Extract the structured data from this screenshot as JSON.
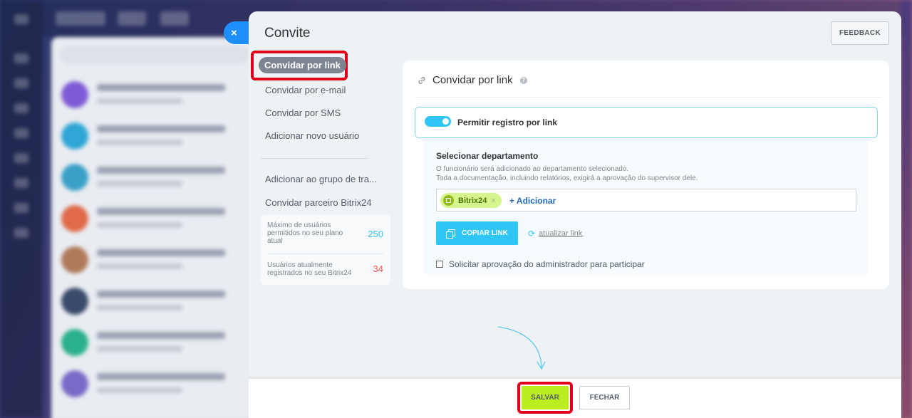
{
  "panel": {
    "title": "Convite",
    "feedback_label": "FEEDBACK",
    "close_glyph": "×"
  },
  "nav": {
    "items": [
      {
        "label": "Convidar por link",
        "active": true
      },
      {
        "label": "Convidar por e-mail"
      },
      {
        "label": "Convidar por SMS"
      },
      {
        "label": "Adicionar novo usuário"
      },
      {
        "label": "Adicionar ao grupo de tra..."
      },
      {
        "label": "Convidar parceiro Bitrix24"
      }
    ],
    "limits": [
      {
        "text": "Máximo de usuários permitidos no seu plano atual",
        "value": "250",
        "color": "#2fc6f6"
      },
      {
        "text": "Usuários atualmente registrados no seu Bitrix24",
        "value": "34",
        "color": "#ff5752"
      }
    ]
  },
  "card": {
    "title": "Convidar por link",
    "help_glyph": "?",
    "toggle_label": "Permitir registro por link",
    "toggle_on": true,
    "dept_title": "Selecionar departamento",
    "dept_desc_1": "O funcionário será adicionado ao departamento selecionado.",
    "dept_desc_2": "Toda a documentação, incluindo relatórios, exigirá a aprovação do supervisor dele.",
    "tag_label": "Bitrix24",
    "tag_remove": "×",
    "add_label": "+ Adicionar",
    "copy_label": "COPIAR LINK",
    "refresh_glyph": "⟳",
    "refresh_label": "atualizar link",
    "approve_label": "Solicitar aprovação do administrador para participar",
    "approve_checked": false
  },
  "footer": {
    "save_label": "SALVAR",
    "close_label": "FECHAR"
  },
  "colors": {
    "accent": "#2fc6f6",
    "save": "#bbed21",
    "highlight": "#e0001b"
  }
}
